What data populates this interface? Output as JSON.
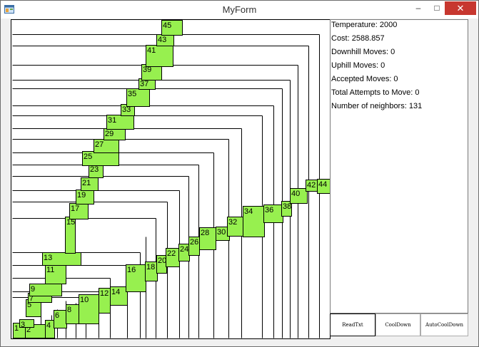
{
  "window": {
    "title": "MyForm",
    "minimize_glyph": "–",
    "maximize_glyph": "□",
    "close_glyph": "✕"
  },
  "app_icon": "form-icon",
  "info": [
    {
      "label": "Temperature: 2000"
    },
    {
      "label": "Cost: 2588.857"
    },
    {
      "label": "Downhill Moves: 0"
    },
    {
      "label": "Uphill Moves: 0"
    },
    {
      "label": "Accepted Moves: 0"
    },
    {
      "label": "Total Attempts to Move: 0"
    },
    {
      "label": "Number of neighbors: 131"
    }
  ],
  "buttons": {
    "readtxt": "ReadTxt",
    "cooldown": "CoolDown",
    "autocooldown": "AutoCoolDown"
  },
  "colors": {
    "block_fill": "#97f04f",
    "block_stroke": "#000000",
    "canvas_bg": "#ffffff",
    "close_red": "#c7372f"
  },
  "blocks": [
    {
      "label": "1"
    },
    {
      "label": "2"
    },
    {
      "label": "3"
    },
    {
      "label": "4"
    },
    {
      "label": "5"
    },
    {
      "label": "6"
    },
    {
      "label": "7"
    },
    {
      "label": "8"
    },
    {
      "label": "9"
    },
    {
      "label": "10"
    },
    {
      "label": "11"
    },
    {
      "label": "12"
    },
    {
      "label": "13"
    },
    {
      "label": "14"
    },
    {
      "label": "15"
    },
    {
      "label": "16"
    },
    {
      "label": "17"
    },
    {
      "label": "18"
    },
    {
      "label": "19"
    },
    {
      "label": "20"
    },
    {
      "label": "21"
    },
    {
      "label": "22"
    },
    {
      "label": "23"
    },
    {
      "label": "24"
    },
    {
      "label": "25"
    },
    {
      "label": "26"
    },
    {
      "label": "27"
    },
    {
      "label": "28"
    },
    {
      "label": "29"
    },
    {
      "label": "30"
    },
    {
      "label": "31"
    },
    {
      "label": "32"
    },
    {
      "label": "33"
    },
    {
      "label": "34"
    },
    {
      "label": "35"
    },
    {
      "label": "36"
    },
    {
      "label": "37"
    },
    {
      "label": "38"
    },
    {
      "label": "39"
    },
    {
      "label": "40"
    },
    {
      "label": "41"
    },
    {
      "label": "42"
    },
    {
      "label": "43"
    },
    {
      "label": "44"
    },
    {
      "label": "45"
    }
  ]
}
